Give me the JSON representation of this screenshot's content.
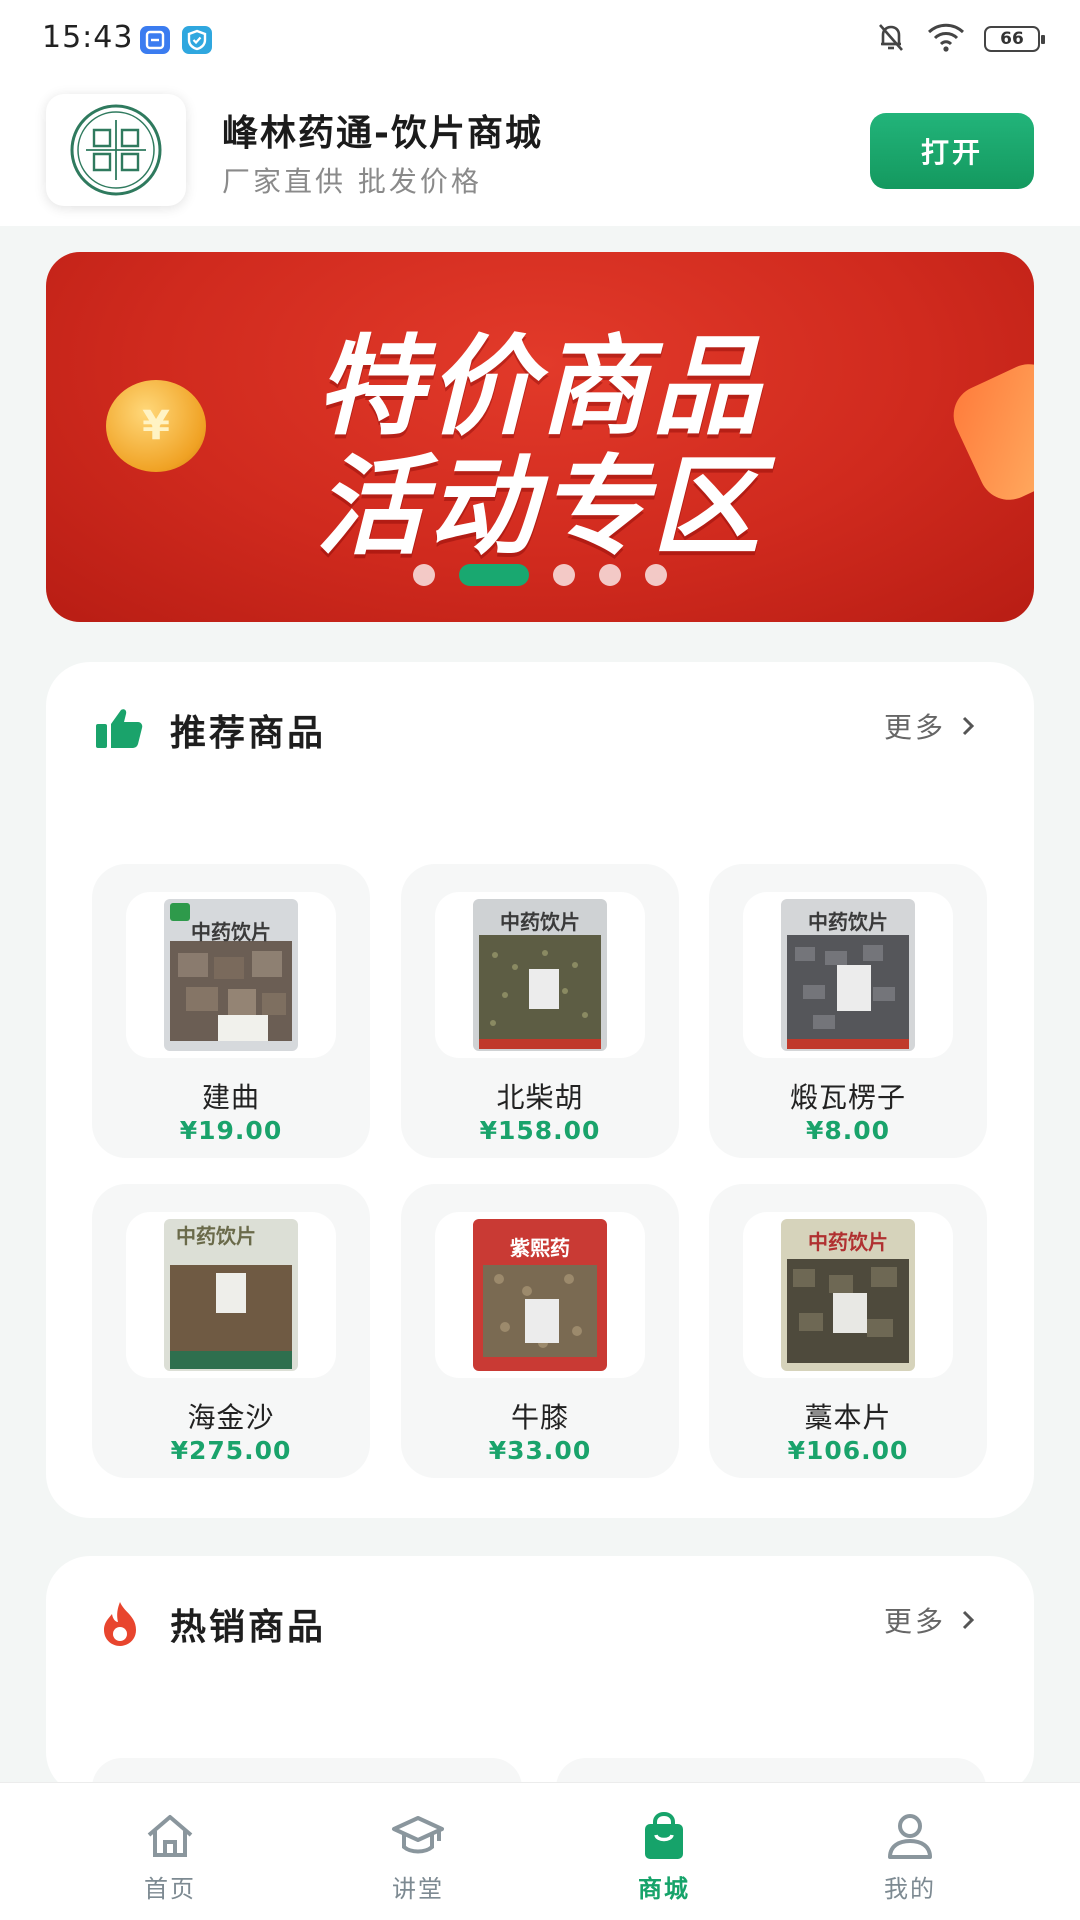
{
  "status_bar": {
    "time": "15:43",
    "battery": "66",
    "icons": [
      "notification-off-icon",
      "wifi-icon",
      "battery-icon"
    ]
  },
  "app_header": {
    "name": "峰林药通-饮片商城",
    "slogan": "厂家直供 批发价格",
    "open_button": "打开"
  },
  "banner": {
    "line1": "特价商品",
    "line2": "活动专区",
    "slide_count": 5,
    "active_slide": 2
  },
  "recommended": {
    "title": "推荐商品",
    "more": "更多",
    "products": [
      {
        "name": "建曲",
        "price": "¥19.00",
        "package_text": "中药饮片"
      },
      {
        "name": "北柴胡",
        "price": "¥158.00",
        "package_text": "中药饮片"
      },
      {
        "name": "煅瓦楞子",
        "price": "¥8.00",
        "package_text": "中药饮片"
      },
      {
        "name": "海金沙",
        "price": "¥275.00",
        "package_text": "中药饮片"
      },
      {
        "name": "牛膝",
        "price": "¥33.00",
        "package_text": "紫熙药"
      },
      {
        "name": "藁本片",
        "price": "¥106.00",
        "package_text": "中药饮片"
      }
    ]
  },
  "hot_sales": {
    "title": "热销商品",
    "more": "更多"
  },
  "bottom_nav": {
    "items": [
      {
        "label": "首页",
        "icon": "home-icon"
      },
      {
        "label": "讲堂",
        "icon": "graduation-cap-icon"
      },
      {
        "label": "商城",
        "icon": "shopping-bag-icon"
      },
      {
        "label": "我的",
        "icon": "user-icon"
      }
    ],
    "active_index": 2
  },
  "colors": {
    "accent": "#16a36a",
    "banner_red": "#d02a1e",
    "background": "#f3f6f5"
  }
}
